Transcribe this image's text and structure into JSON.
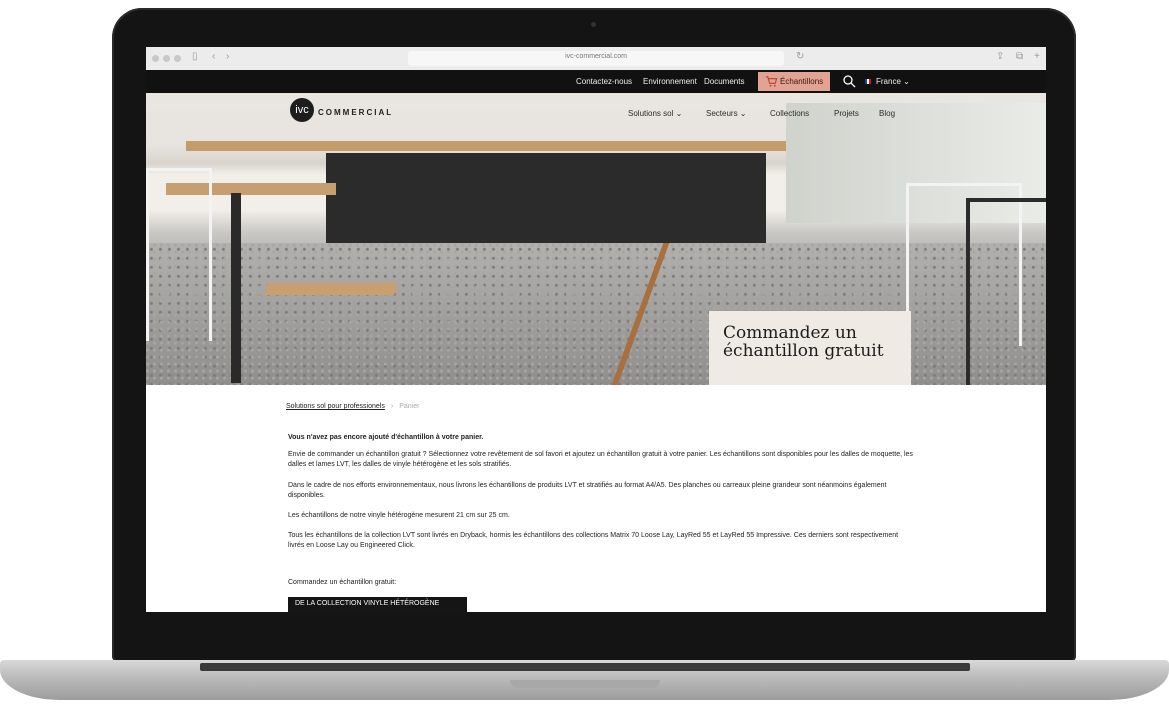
{
  "browser": {
    "url": "ivc-commercial.com"
  },
  "topbar": {
    "links": [
      "Contactez-nous",
      "Environnement",
      "Documents"
    ],
    "samples_label": "Échantillons",
    "language": "France"
  },
  "header": {
    "logo_mark": "ivc",
    "logo_text": "COMMERCIAL",
    "nav": [
      "Solutions sol",
      "Secteurs",
      "Collections",
      "Projets",
      "Blog"
    ]
  },
  "hero": {
    "title_line1": "Commandez un",
    "title_line2": "échantillon gratuit"
  },
  "breadcrumb": {
    "home": "Solutions sol pour professionels",
    "current": "Panier"
  },
  "content": {
    "empty_title": "Vous n'avez pas encore ajouté d'échantillon à votre panier.",
    "paragraphs": [
      "Envie de commander un échantillon gratuit ? Sélectionnez votre revêtement de sol favori et ajoutez un échantillon gratuit à votre panier. Les échantillons sont disponibles pour les dalles de moquette, les dalles et lames LVT, les dalles de vinyle hétérogène et les sols stratifiés.",
      "Dans le cadre de nos efforts environnementaux, nous livrons les échantillons de produits LVT et stratifiés au format A4/A5. Des planches ou carreaux pleine grandeur sont néanmoins également disponibles.",
      "Les échantillons de notre vinyle hétérogène mesurent 21 cm sur 25 cm.",
      "Tous les échantillons de la collection LVT sont livrés en Dryback, hormis les échantillons des collections Matrix 70 Loose Lay, LayRed 55 et LayRed 55 Impressive. Ces derniers sont respectivement livrés en Loose Lay ou Engineered Click."
    ],
    "order_prompt": "Commandez un échantillon gratuit:",
    "collection_button": "DE LA COLLECTION VINYLE HÉTÉROGÈNE"
  },
  "colors": {
    "samples_button": "#e3a393",
    "topbar": "#111111"
  }
}
